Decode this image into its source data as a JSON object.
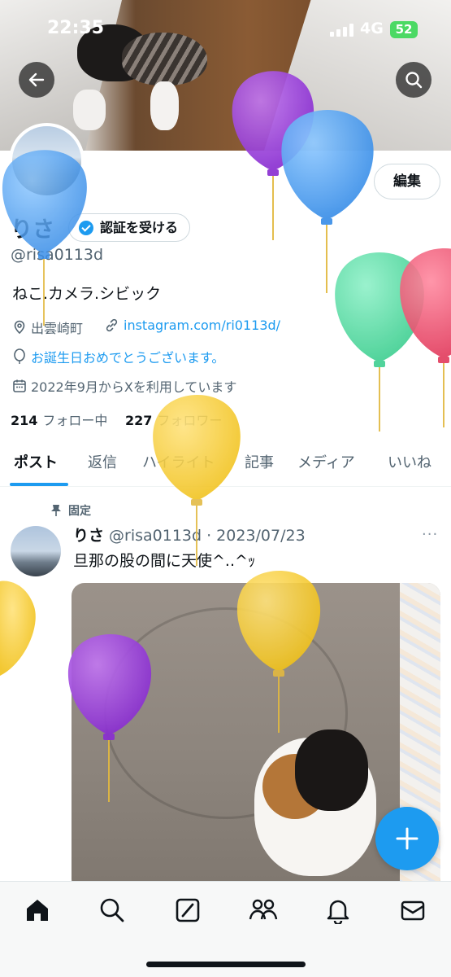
{
  "status_bar": {
    "time": "22:35",
    "network": "4G",
    "battery": "52"
  },
  "profile": {
    "name": "りさ",
    "verify_button": "認証を受ける",
    "handle": "@risa0113d",
    "bio": "ねこ.カメラ.シビック",
    "location": "出雲崎町",
    "website": "instagram.com/ri0113d/",
    "birthday": "お誕生日おめでとうございます。",
    "joined": "2022年9月からXを利用しています",
    "following_count": "214",
    "following_label": "フォロー中",
    "followers_count": "227",
    "followers_label": "フォロワー",
    "edit_button": "編集"
  },
  "tabs": [
    "ポスト",
    "返信",
    "ハイライト",
    "記事",
    "メディア",
    "いいね"
  ],
  "post": {
    "pinned_label": "固定",
    "author": "りさ",
    "meta": "@risa0113d · 2023/07/23",
    "more": "···",
    "text": "旦那の股の間に天使^..^ｯ"
  },
  "icons": {
    "back": "back-arrow-icon",
    "search": "search-icon",
    "location": "location-pin-icon",
    "link": "link-icon",
    "balloon": "balloon-icon",
    "calendar": "calendar-icon",
    "pin": "pin-icon",
    "compose": "plus-icon",
    "nav": [
      "home-icon",
      "search-icon",
      "grok-icon",
      "communities-icon",
      "notifications-icon",
      "messages-icon"
    ]
  },
  "colors": {
    "accent": "#1d9bf0",
    "text": "#0f1419",
    "secondary": "#536471"
  }
}
